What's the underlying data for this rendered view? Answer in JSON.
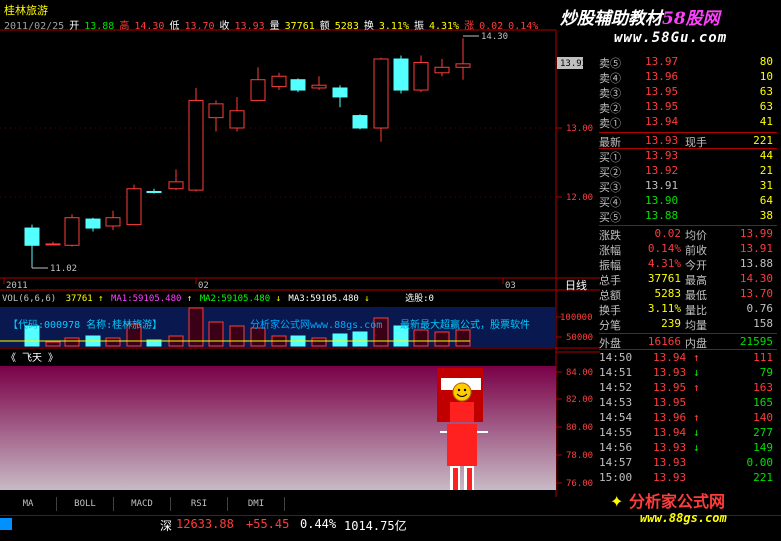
{
  "stock": {
    "name": "桂林旅游"
  },
  "info_line": {
    "date": "2011/02/25",
    "open_label": "开",
    "open": "13.88",
    "high_label": "高",
    "high": "14.30",
    "low_label": "低",
    "low": "13.70",
    "close_label": "收",
    "close": "13.93",
    "volume_label": "量",
    "volume": "37761",
    "amount_label": "额",
    "amount": "5283",
    "turnover_label": "换",
    "turnover": "3.11%",
    "amplitude_label": "振",
    "amplitude": "4.31%",
    "change_label": "涨",
    "change": "0.02",
    "change_pct": "0.14%"
  },
  "watermark": {
    "text_a": "炒股辅助教材",
    "text_b": "58股网",
    "url": "www.58Gu.com"
  },
  "price_axis": {
    "current": "13.93",
    "tick_13": "13.00",
    "tick_12": "12.00"
  },
  "chart_labels": {
    "max": "14.30",
    "min": "11.02",
    "month_1": "2011",
    "month_2": "02",
    "month_3": "03",
    "period": "日线"
  },
  "volume_line": {
    "title": "VOL(6,6,6)",
    "vol": "37761",
    "ma1": "MA1:59105.480",
    "ma2": "MA2:59105.480",
    "ma3": "MA3:59105.480",
    "select": "选股:0",
    "axis_100000": "100000",
    "axis_50000": "50000"
  },
  "banner": {
    "code_text": "【代码:000978 名称:桂林旅游】",
    "site_text": "分析家公式网www.88gs.com",
    "ad_text": "最新最大超赢公式，股票软件"
  },
  "indicator": {
    "title": "《 飞天 》",
    "axis": [
      "84.00",
      "82.00",
      "80.00",
      "78.00",
      "76.00"
    ]
  },
  "orderbook": {
    "sell": [
      {
        "label": "卖⑤",
        "price": "13.97",
        "vol": "80"
      },
      {
        "label": "卖④",
        "price": "13.96",
        "vol": "10"
      },
      {
        "label": "卖③",
        "price": "13.95",
        "vol": "63"
      },
      {
        "label": "卖②",
        "price": "13.95",
        "vol": "63"
      },
      {
        "label": "卖①",
        "price": "13.94",
        "vol": "41"
      }
    ],
    "latest": {
      "label": "最新",
      "price": "13.93",
      "now_label": "现手",
      "now": "221"
    },
    "buy": [
      {
        "label": "买①",
        "price": "13.93",
        "vol": "44"
      },
      {
        "label": "买②",
        "price": "13.92",
        "vol": "21"
      },
      {
        "label": "买③",
        "price": "13.91",
        "vol": "31"
      },
      {
        "label": "买④",
        "price": "13.90",
        "vol": "64"
      },
      {
        "label": "买⑤",
        "price": "13.88",
        "vol": "38"
      }
    ]
  },
  "stats": [
    {
      "l1": "涨跌",
      "v1": "0.02",
      "l2": "均价",
      "v2": "13.99"
    },
    {
      "l1": "涨幅",
      "v1": "0.14%",
      "l2": "前收",
      "v2": "13.91"
    },
    {
      "l1": "振幅",
      "v1": "4.31%",
      "l2": "今开",
      "v2": "13.88"
    },
    {
      "l1": "总手",
      "v1": "37761",
      "l2": "最高",
      "v2": "14.30"
    },
    {
      "l1": "总额",
      "v1": "5283",
      "l2": "最低",
      "v2": "13.70"
    },
    {
      "l1": "换手",
      "v1": "3.11%",
      "l2": "量比",
      "v2": "0.76"
    },
    {
      "l1": "分笔",
      "v1": "239",
      "l2": "均量",
      "v2": "158"
    }
  ],
  "outer_inner": {
    "outer_label": "外盘",
    "outer": "16166",
    "inner_label": "内盘",
    "inner": "21595"
  },
  "ticks": [
    {
      "time": "14:50",
      "price": "13.94",
      "dir": "↑",
      "vol": "111"
    },
    {
      "time": "14:51",
      "price": "13.93",
      "dir": "↓",
      "vol": "79"
    },
    {
      "time": "14:52",
      "price": "13.95",
      "dir": "↑",
      "vol": "163"
    },
    {
      "time": "14:53",
      "price": "13.95",
      "dir": "",
      "vol": "165"
    },
    {
      "time": "14:54",
      "price": "13.96",
      "dir": "↑",
      "vol": "140"
    },
    {
      "time": "14:55",
      "price": "13.94",
      "dir": "↓",
      "vol": "277"
    },
    {
      "time": "14:56",
      "price": "13.93",
      "dir": "↓",
      "vol": "149"
    },
    {
      "time": "14:57",
      "price": "13.93",
      "dir": "",
      "vol": "0.00"
    },
    {
      "time": "15:00",
      "price": "13.93",
      "dir": "",
      "vol": "221"
    }
  ],
  "tabs": [
    "MA",
    "BOLL",
    "MACD",
    "RSI",
    "DMI"
  ],
  "status": {
    "market": "深",
    "index": "12633.88",
    "change": "+55.45",
    "pct": "0.44%",
    "amount": "1014.75亿"
  },
  "footer": {
    "logo": "分析家公式网",
    "url": "www.88gs.com"
  }
}
